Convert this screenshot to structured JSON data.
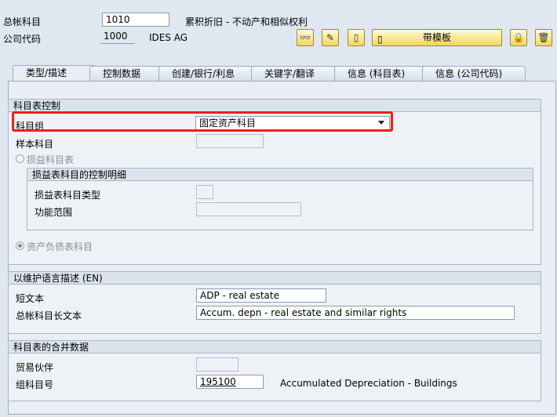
{
  "header": {
    "gl_account_label": "总帐科目",
    "gl_account_value": "1010",
    "gl_account_desc": "累积折旧 - 不动产和相似权利",
    "company_code_label": "公司代码",
    "company_code_value": "1000",
    "company_code_desc": "IDES AG",
    "template_button_label": "带模板"
  },
  "tabs": [
    {
      "label": "类型/描述"
    },
    {
      "label": "控制数据"
    },
    {
      "label": "创建/银行/利息"
    },
    {
      "label": "关键字/翻译"
    },
    {
      "label": "信息 (科目表)"
    },
    {
      "label": "信息 (公司代码)"
    }
  ],
  "coa_control": {
    "title": "科目表控制",
    "account_group_label": "科目组",
    "account_group_value": "固定资产科目",
    "sample_account_label": "样本科目",
    "sample_account_value": "",
    "pl_radio_label": "损益科目表",
    "pl_sub_title": "损益表科目的控制明细",
    "pl_type_label": "损益表科目类型",
    "pl_type_value": "",
    "func_area_label": "功能范围",
    "func_area_value": "",
    "bs_radio_label": "资产负债表科目"
  },
  "description": {
    "title": "以维护语言描述 (EN)",
    "short_text_label": "短文本",
    "short_text_value": "ADP - real estate",
    "long_text_label": "总帐科目长文本",
    "long_text_value": "Accum. depn - real estate and similar rights"
  },
  "consolidation": {
    "title": "科目表的合并数据",
    "trading_partner_label": "贸易伙伴",
    "trading_partner_value": "",
    "group_account_label": "组科目号",
    "group_account_value": "195100",
    "group_account_desc": "Accumulated Depreciation - Buildings"
  },
  "colors": {
    "background": "#dfe8f1",
    "highlight": "#ff1a1a",
    "button": "#f3d65e"
  }
}
